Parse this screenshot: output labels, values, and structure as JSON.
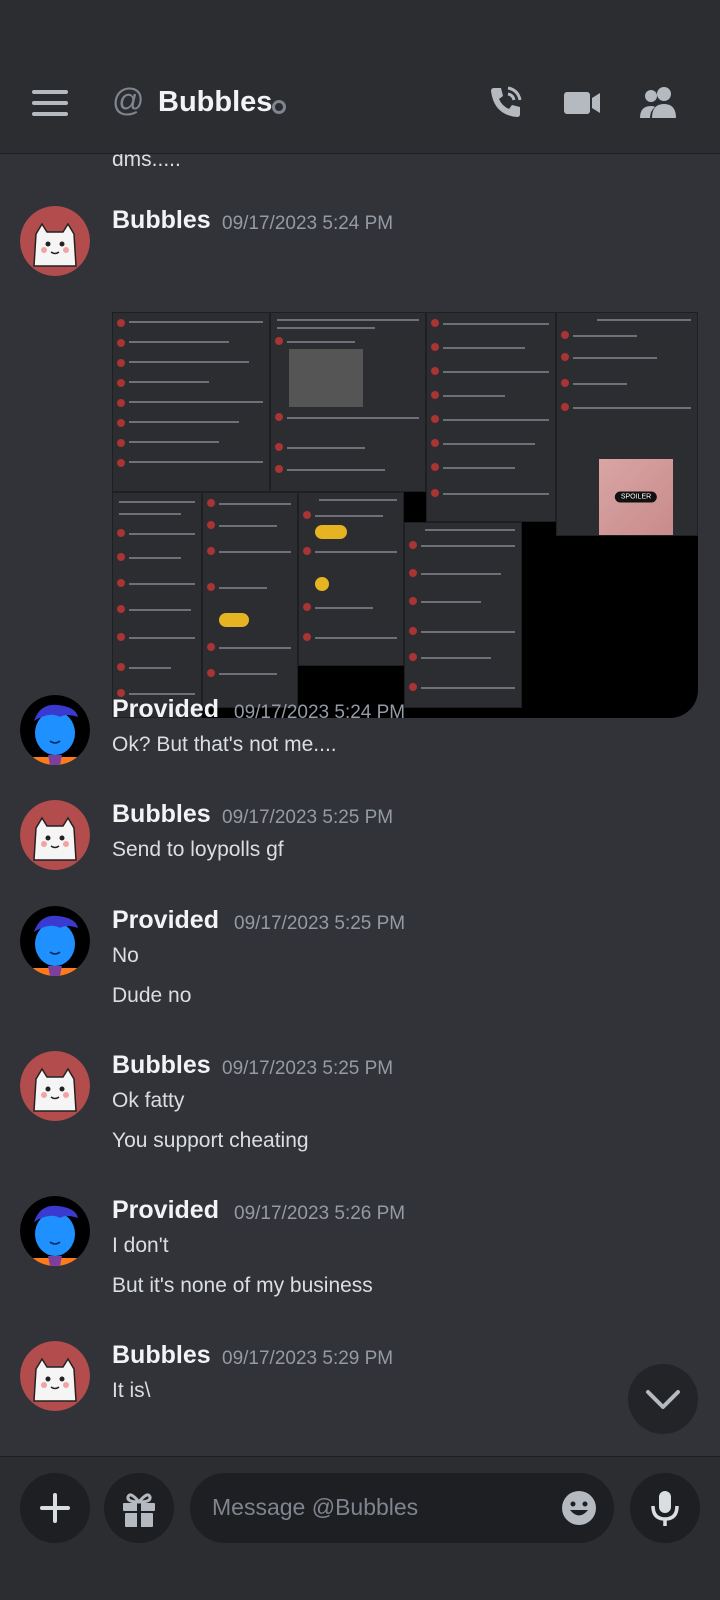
{
  "header": {
    "title": "Bubbles"
  },
  "feed": {
    "partial_text": "dms.....",
    "messages": [
      {
        "author": "Bubbles",
        "timestamp": "09/17/2023 5:24 PM",
        "lines": []
      },
      {
        "author": "Provided",
        "timestamp": "09/17/2023 5:24 PM",
        "lines": [
          "Ok? But that's not me...."
        ]
      },
      {
        "author": "Bubbles",
        "timestamp": "09/17/2023 5:25 PM",
        "lines": [
          "Send to loypolls gf"
        ]
      },
      {
        "author": "Provided",
        "timestamp": "09/17/2023 5:25 PM",
        "lines": [
          "No",
          "Dude no"
        ]
      },
      {
        "author": "Bubbles",
        "timestamp": "09/17/2023 5:25 PM",
        "lines": [
          "Ok fatty",
          "You support cheating"
        ]
      },
      {
        "author": "Provided",
        "timestamp": "09/17/2023 5:26 PM",
        "lines": [
          "I don't",
          "But it's none of my business"
        ]
      },
      {
        "author": "Bubbles",
        "timestamp": "09/17/2023 5:29 PM",
        "lines": [
          "It is\\"
        ]
      }
    ],
    "attachment_spoiler_label": "SPOILER"
  },
  "composer": {
    "placeholder": "Message @Bubbles"
  },
  "icons": {
    "menu": "hamburger-icon",
    "at": "at-icon",
    "call": "phone-call-icon",
    "video": "video-camera-icon",
    "members": "members-icon",
    "add": "plus-icon",
    "gift": "gift-icon",
    "emoji": "smile-icon",
    "mic": "microphone-icon",
    "scroll": "chevron-down-icon"
  },
  "colors": {
    "background": "#313338",
    "header": "#2b2d31",
    "input": "#1e1f22",
    "bubbles_avatar_ring": "#b34c4c",
    "provided_avatar_blue": "#1e90ff"
  }
}
